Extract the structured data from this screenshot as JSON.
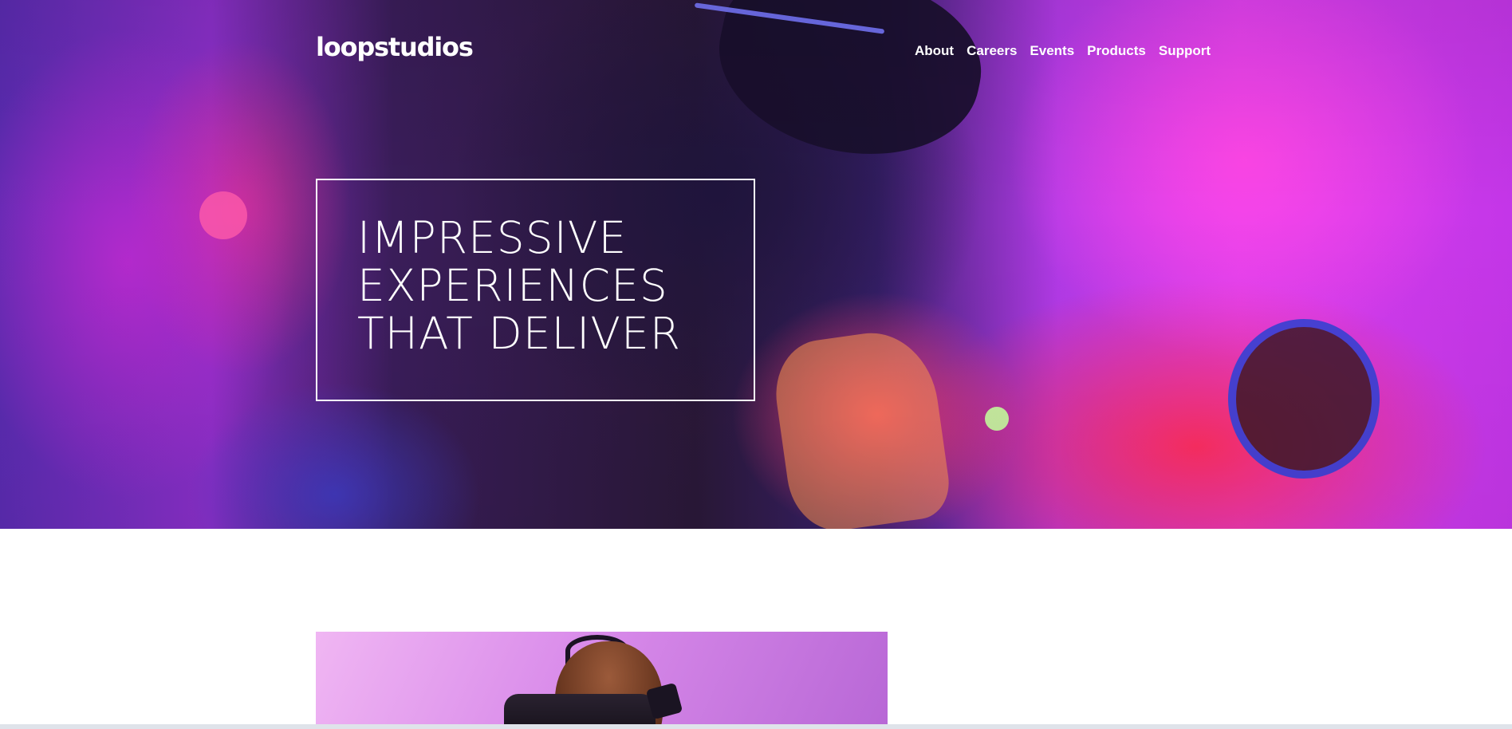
{
  "brand": {
    "logo_text": "loopstudios"
  },
  "nav": {
    "items": [
      {
        "label": "About"
      },
      {
        "label": "Careers"
      },
      {
        "label": "Events"
      },
      {
        "label": "Products"
      },
      {
        "label": "Support"
      }
    ]
  },
  "hero": {
    "title": "IMPRESSIVE\nEXPERIENCES\nTHAT DELIVER",
    "accent_colors": [
      "#2a1838",
      "#c436e8",
      "#ff2d5a",
      "#4a3ac8"
    ]
  },
  "feature": {
    "image_description_icon": "vr-headset-photo",
    "background_color": "#d98bea"
  }
}
